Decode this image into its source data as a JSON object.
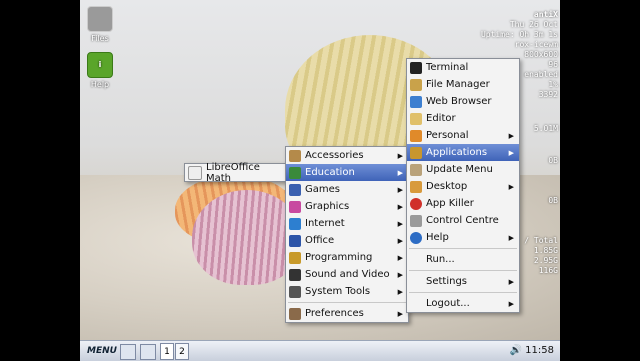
{
  "desktop": {
    "icons": [
      {
        "label": "Files",
        "color": "#9a9a9a"
      },
      {
        "label": "Help",
        "color": "#5aa52a"
      }
    ]
  },
  "conky": {
    "lines": [
      "antiX",
      "Thu 26 Oct",
      "Uptime: 0h 3m 1s",
      "rox-icewm",
      "800x600",
      "96",
      "enabled",
      "1%",
      "3392",
      "5.01M",
      "0B",
      "0B",
      "/ Total",
      "1.85G",
      "2.95G",
      "116G"
    ]
  },
  "main_menu": {
    "items": [
      {
        "label": "Terminal",
        "icon": "terminal-icon",
        "color": "#222"
      },
      {
        "label": "File Manager",
        "icon": "file-manager-icon",
        "color": "#c9a24a"
      },
      {
        "label": "Web Browser",
        "icon": "web-browser-icon",
        "color": "#3d7fd0"
      },
      {
        "label": "Editor",
        "icon": "editor-icon",
        "color": "#e0c06a"
      },
      {
        "label": "Personal",
        "icon": "personal-icon",
        "color": "#e08a2a",
        "submenu": true
      },
      {
        "label": "Applications",
        "icon": "applications-icon",
        "color": "#c7962e",
        "submenu": true,
        "selected": true
      },
      {
        "label": "Update Menu",
        "icon": "update-menu-icon",
        "color": "#b9a27a"
      },
      {
        "label": "Desktop",
        "icon": "desktop-icon",
        "color": "#d89a3c",
        "submenu": true
      },
      {
        "label": "App Killer",
        "icon": "app-killer-icon",
        "color": "#d0302a"
      },
      {
        "label": "Control Centre",
        "icon": "control-centre-icon",
        "color": "#9a9a9a"
      },
      {
        "label": "Help",
        "icon": "help-icon",
        "color": "#2d6cc4",
        "submenu": true
      },
      {
        "label": "Run...",
        "icon": "",
        "color": ""
      },
      {
        "label": "Settings",
        "icon": "",
        "color": "",
        "submenu": true
      },
      {
        "label": "Logout...",
        "icon": "",
        "color": "",
        "submenu": true
      }
    ]
  },
  "apps_menu": {
    "items": [
      {
        "label": "Accessories",
        "color": "#b48a4a"
      },
      {
        "label": "Education",
        "color": "#3a8a3a",
        "selected": true
      },
      {
        "label": "Games",
        "color": "#3a60b0"
      },
      {
        "label": "Graphics",
        "color": "#c84aa0"
      },
      {
        "label": "Internet",
        "color": "#2d7fd0"
      },
      {
        "label": "Office",
        "color": "#2d55a8"
      },
      {
        "label": "Programming",
        "color": "#c89a2a"
      },
      {
        "label": "Sound and Video",
        "color": "#333"
      },
      {
        "label": "System Tools",
        "color": "#555"
      },
      {
        "label": "Preferences",
        "color": "#8a6a4a"
      }
    ]
  },
  "education_menu": {
    "items": [
      {
        "label": "LibreOffice Math",
        "color": "#eeeeee"
      }
    ]
  },
  "taskbar": {
    "menu_label": "MENU",
    "workspaces": [
      "1",
      "2"
    ],
    "clock": "11:58",
    "volume_icon": "🔊"
  }
}
